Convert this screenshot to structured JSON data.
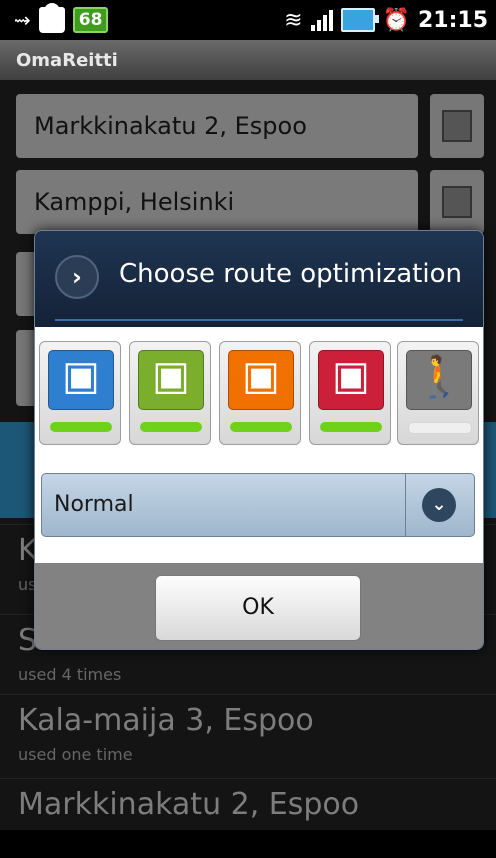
{
  "status_bar": {
    "notification_count": "68",
    "time": "21:15",
    "icons": [
      "usb-icon",
      "android-icon",
      "wifi-icon",
      "signal-icon",
      "battery-icon",
      "alarm-icon"
    ]
  },
  "app": {
    "title": "OmaReitti"
  },
  "route": {
    "from": "Markkinakatu 2, Espoo",
    "to": "Kamppi, Helsinki"
  },
  "history": [
    {
      "name": "K",
      "sub": "us"
    },
    {
      "name": "S",
      "sub": "used 4 times"
    },
    {
      "name": "Kala-maija 3, Espoo",
      "sub": "used one time"
    },
    {
      "name": "Markkinakatu 2, Espoo",
      "sub": ""
    }
  ],
  "dialog": {
    "title": "Choose route optimization",
    "modes": [
      {
        "name": "bus",
        "icon": "bus-icon",
        "color": "#2f7fd0",
        "enabled": true
      },
      {
        "name": "tram",
        "icon": "tram-icon",
        "color": "#7aae2c",
        "enabled": true
      },
      {
        "name": "metro",
        "icon": "metro-icon",
        "color": "#f07000",
        "enabled": true
      },
      {
        "name": "train",
        "icon": "train-icon",
        "color": "#cc1f3a",
        "enabled": true
      },
      {
        "name": "walk",
        "icon": "walk-icon",
        "color": "#7a7a7a",
        "enabled": false
      }
    ],
    "enabled_bar_color": "#6fd11a",
    "disabled_bar_color": "#efefef",
    "optimization_value": "Normal",
    "ok_label": "OK"
  }
}
